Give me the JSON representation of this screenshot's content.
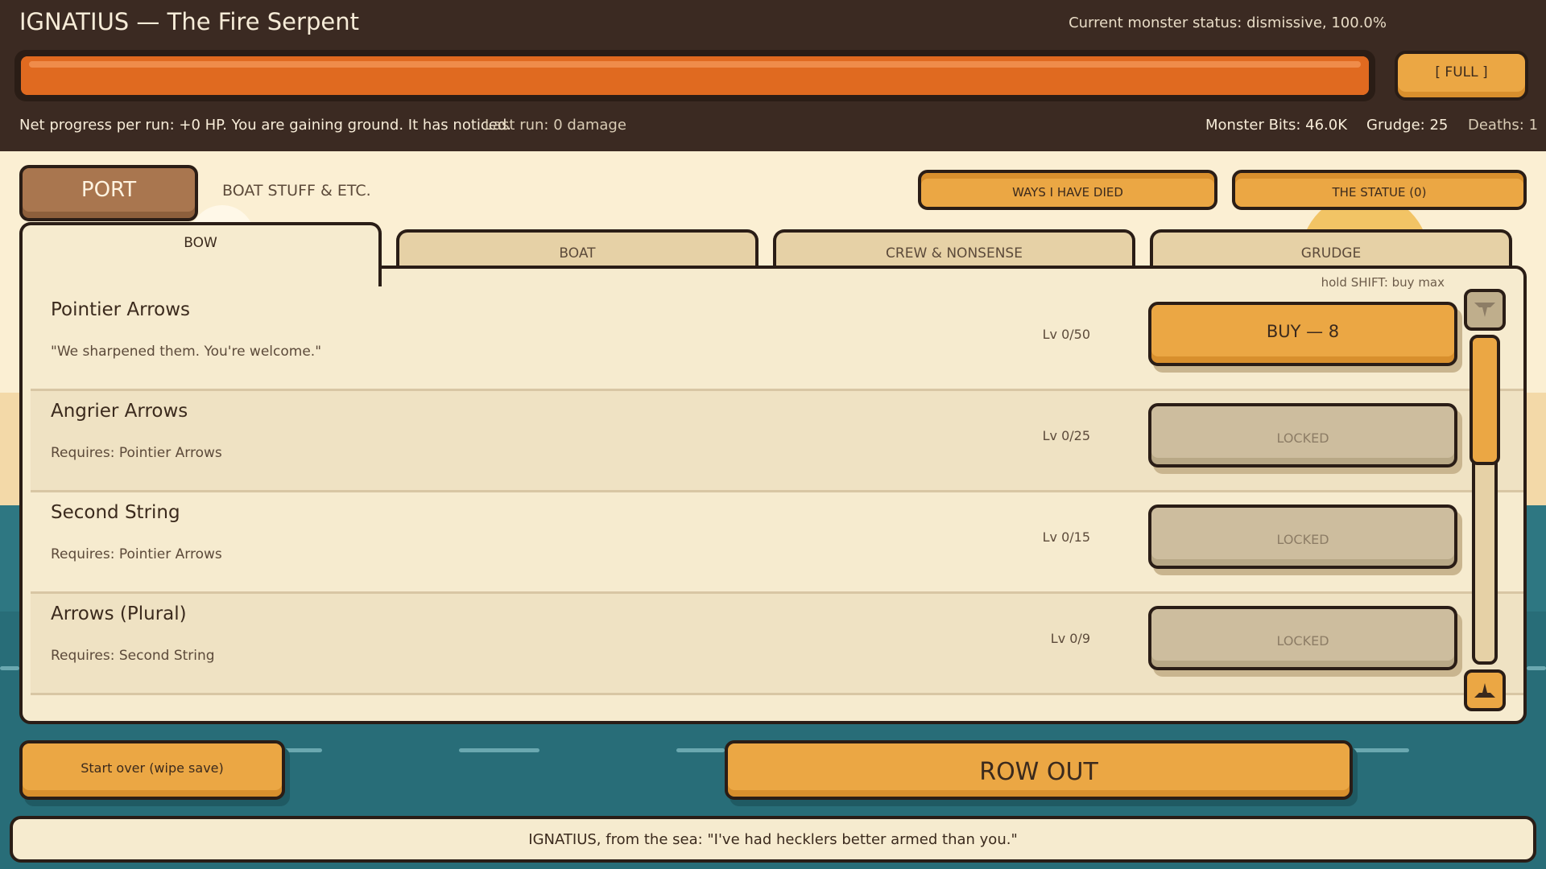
{
  "header": {
    "title": "IGNATIUS — The Fire Serpent",
    "status": "Current monster status: dismissive, 100.0%",
    "hp_fraction": 1.0,
    "full_label": "[ FULL ]",
    "net_progress": "Net progress per run: +0 HP. You are gaining ground. It has noticed.",
    "last_run": "Last run: 0 damage",
    "monster_bits": "Monster Bits: 46.0K",
    "grudge": "Grudge: 25",
    "deaths": "Deaths: 1"
  },
  "nav": {
    "port_label": "PORT",
    "port_subtitle": "BOAT STUFF & ETC.",
    "ways_died_label": "WAYS I HAVE DIED",
    "statue_label": "THE STATUE (0)"
  },
  "tabs": [
    {
      "label": "BOW"
    },
    {
      "label": "BOAT"
    },
    {
      "label": "CREW & NONSENSE"
    },
    {
      "label": "GRUDGE"
    }
  ],
  "shop": {
    "hint": "hold SHIFT: buy max",
    "items": [
      {
        "name": "Pointier Arrows",
        "desc": "\"We sharpened them. You're welcome.\"",
        "level": "Lv 0/50",
        "button": "BUY — 8"
      },
      {
        "name": "Angrier Arrows",
        "desc": "Requires: Pointier Arrows",
        "level": "Lv 0/25",
        "button": "LOCKED"
      },
      {
        "name": "Second String",
        "desc": "Requires: Pointier Arrows",
        "level": "Lv 0/15",
        "button": "LOCKED"
      },
      {
        "name": "Arrows (Plural)",
        "desc": "Requires: Second String",
        "level": "Lv 0/9",
        "button": "LOCKED"
      }
    ]
  },
  "bottom": {
    "reset_label": "Start over (wipe save)",
    "row_out_label": "ROW OUT",
    "taunt": "IGNATIUS, from the sea: \"I've had hecklers better armed than you.\""
  },
  "colors": {
    "header_bg": "#3b2a22",
    "hp_fill": "#e06a20",
    "button": "#eba744",
    "locked": "#cdbd9e",
    "panel": "#f6ebcf",
    "sea": "#2e7782"
  },
  "icons": {
    "scroll_up": "triangle-down-icon",
    "scroll_down": "triangle-up-icon"
  }
}
